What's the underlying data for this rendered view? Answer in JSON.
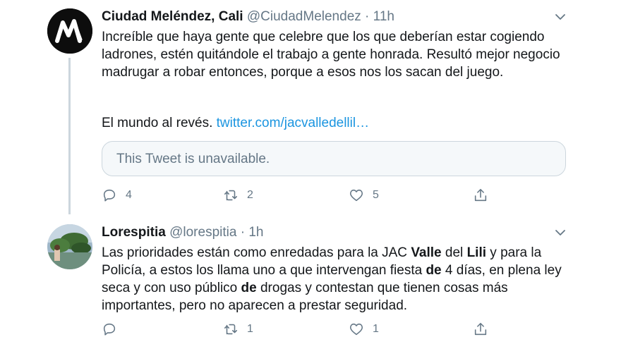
{
  "tweets": [
    {
      "name": "Ciudad Meléndez, Cali",
      "handle": "@CiudadMelendez",
      "separator": "·",
      "time": "11h",
      "text": "Increíble que haya gente que celebre que los que deberían estar cogiendo ladrones, estén quitándole el trabajo a gente honrada. Resultó mejor negocio madrugar a robar entonces, porque a esos nos los sacan del juego.",
      "text2_prefix": "El mundo al revés.",
      "link": "twitter.com/jacvalledellil…",
      "quoted": "This Tweet is unavailable.",
      "replies": "4",
      "retweets": "2",
      "likes": "5"
    },
    {
      "name": "Lorespitia",
      "handle": "@lorespitia",
      "separator": "·",
      "time": "1h",
      "text_parts": {
        "p1": "Las prioridades están como enredadas para la JAC ",
        "b1": "Valle",
        "p2": " del ",
        "b2": "Lili",
        "p3": " y para la Policía, a estos los llama uno a que intervengan fiesta ",
        "b3": "de",
        "p4": " 4 días, en plena ley seca y con uso público ",
        "b4": "de",
        "p5": " drogas y contestan que tienen cosas más importantes, pero no aparecen a prestar seguridad."
      },
      "replies": "",
      "retweets": "1",
      "likes": "1"
    }
  ],
  "colors": {
    "text": "#14171a",
    "secondary": "#657786",
    "link": "#1b95e0",
    "border": "#ccd6dd"
  },
  "icons": [
    "reply-icon",
    "retweet-icon",
    "like-icon",
    "share-icon",
    "chevron-down-icon"
  ]
}
